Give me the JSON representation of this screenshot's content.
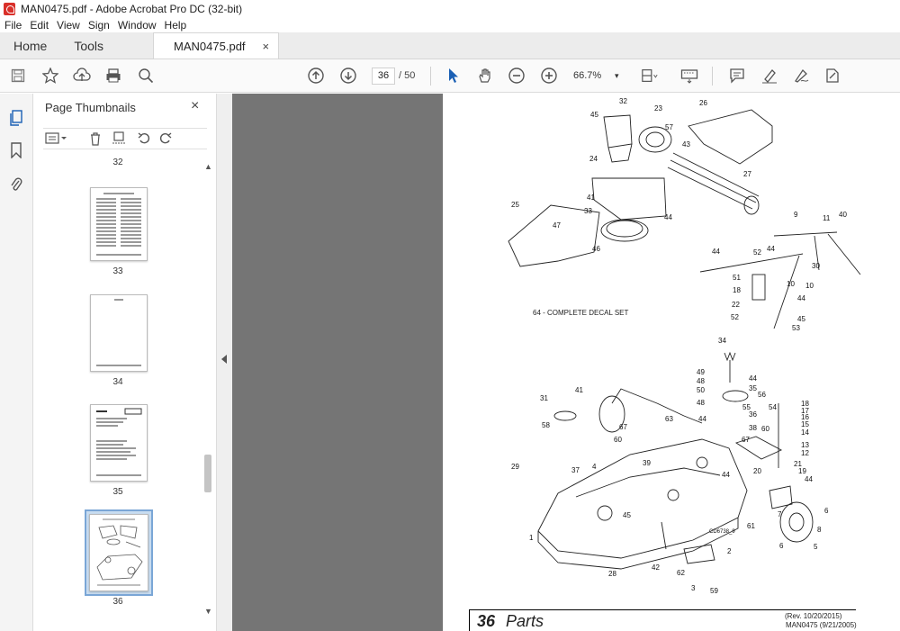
{
  "window": {
    "title": "MAN0475.pdf - Adobe Acrobat Pro DC (32-bit)"
  },
  "menu": [
    "File",
    "Edit",
    "View",
    "Sign",
    "Window",
    "Help"
  ],
  "tabs": {
    "home": "Home",
    "tools": "Tools",
    "document": "MAN0475.pdf",
    "close": "×"
  },
  "toolbar": {
    "page_current": "36",
    "page_total": "/ 50",
    "zoom": "66.7%"
  },
  "thumbnails": {
    "header": "Page Thumbnails",
    "close": "×",
    "pages": [
      {
        "label": "32"
      },
      {
        "label": "33"
      },
      {
        "label": "34"
      },
      {
        "label": "35"
      },
      {
        "label": "36",
        "selected": true
      }
    ]
  },
  "document": {
    "page_number": "36",
    "page_title": "Parts",
    "revision": "(Rev. 10/20/2015)",
    "manual_ref": "MAN0475 (9/21/2005)",
    "decal_note": "64 - COMPLETE DECAL SET",
    "drawing_id": "CD6738_9"
  },
  "callouts": [
    "32",
    "45",
    "23",
    "26",
    "57",
    "43",
    "24",
    "27",
    "41",
    "44",
    "25",
    "33",
    "47",
    "9",
    "11",
    "40",
    "46",
    "44",
    "52",
    "44",
    "30",
    "10",
    "51",
    "18",
    "10",
    "22",
    "44",
    "52",
    "45",
    "53",
    "34",
    "49",
    "48",
    "50",
    "48",
    "44",
    "35",
    "56",
    "31",
    "41",
    "55",
    "54",
    "36",
    "18",
    "17",
    "16",
    "15",
    "58",
    "67",
    "60",
    "63",
    "44",
    "38",
    "14",
    "60",
    "13",
    "12",
    "67",
    "20",
    "21",
    "29",
    "37",
    "4",
    "39",
    "44",
    "19",
    "44",
    "61",
    "7",
    "6",
    "45",
    "8",
    "6",
    "5",
    "1",
    "2",
    "28",
    "42",
    "62",
    "3",
    "59"
  ]
}
